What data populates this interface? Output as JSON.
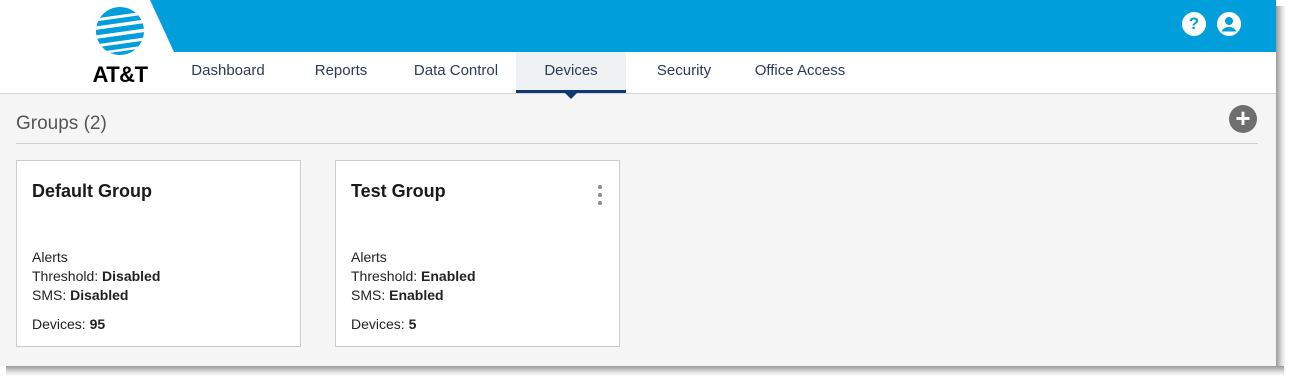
{
  "brand": {
    "name": "AT&T"
  },
  "header": {
    "help_icon": "question-circle",
    "user_icon": "user-circle",
    "help_glyph": "?",
    "accent": "#009fdb"
  },
  "nav": {
    "tabs": [
      {
        "label": "Dashboard"
      },
      {
        "label": "Reports"
      },
      {
        "label": "Data Control"
      },
      {
        "label": "Devices"
      },
      {
        "label": "Security"
      },
      {
        "label": "Office Access"
      }
    ],
    "active": "Devices"
  },
  "groups": {
    "title": "Groups (2)",
    "add_glyph": "+",
    "cards": [
      {
        "name": "Default Group",
        "alerts_label": "Alerts",
        "threshold_label": "Threshold: ",
        "threshold_value": "Disabled",
        "sms_label": "SMS: ",
        "sms_value": "Disabled",
        "devices_label": "Devices: ",
        "devices_value": "95"
      },
      {
        "name": "Test Group",
        "alerts_label": "Alerts",
        "threshold_label": "Threshold: ",
        "threshold_value": "Enabled",
        "sms_label": "SMS: ",
        "sms_value": "Enabled",
        "devices_label": "Devices: ",
        "devices_value": "5"
      }
    ]
  }
}
